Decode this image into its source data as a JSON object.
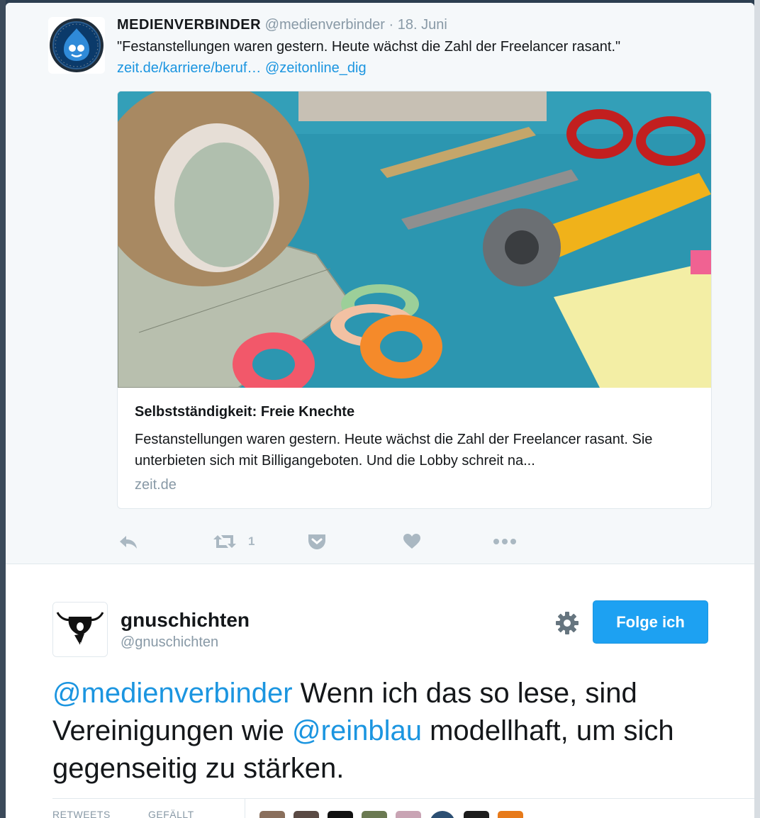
{
  "parent_tweet": {
    "name": "MEDIENVERBINDER",
    "handle": "@medienverbinder",
    "separator": "·",
    "date": "18. Juni",
    "text": "\"Festanstellungen waren gestern. Heute wächst die Zahl der Freelancer rasant.\"",
    "link_url": "zeit.de/karriere/beruf…",
    "link_mention": "@zeitonline_dig",
    "card": {
      "title": "Selbstständigkeit: Freie Knechte",
      "description": "Festanstellungen waren gestern. Heute wächst die Zahl der Freelancer rasant. Sie unterbieten sich mit Billigangeboten. Und die Lobby schreit na...",
      "domain": "zeit.de"
    },
    "actions": {
      "reply_icon": "reply-icon",
      "retweet_icon": "retweet-icon",
      "retweet_count": "1",
      "pocket_icon": "pocket-icon",
      "like_icon": "heart-icon",
      "more_icon": "more-dots-icon"
    }
  },
  "main_tweet": {
    "name": "gnuschichten",
    "handle": "@gnuschichten",
    "follow_label": "Folge ich",
    "settings_icon": "gear-icon",
    "mention_1": "@medienverbinder",
    "text_1": " Wenn ich das so lese, sind Vereinigungen wie ",
    "mention_2": "@reinblau",
    "text_2": " modellhaft, um sich gegenseitig zu stärken.",
    "stats": {
      "retweets_label": "RETWEETS",
      "likes_label": "GEFÄLLT"
    }
  },
  "colors": {
    "link": "#1b95e0",
    "follow_button": "#1da1f2",
    "muted": "#8899a6",
    "action_icon": "#aab8c2"
  }
}
